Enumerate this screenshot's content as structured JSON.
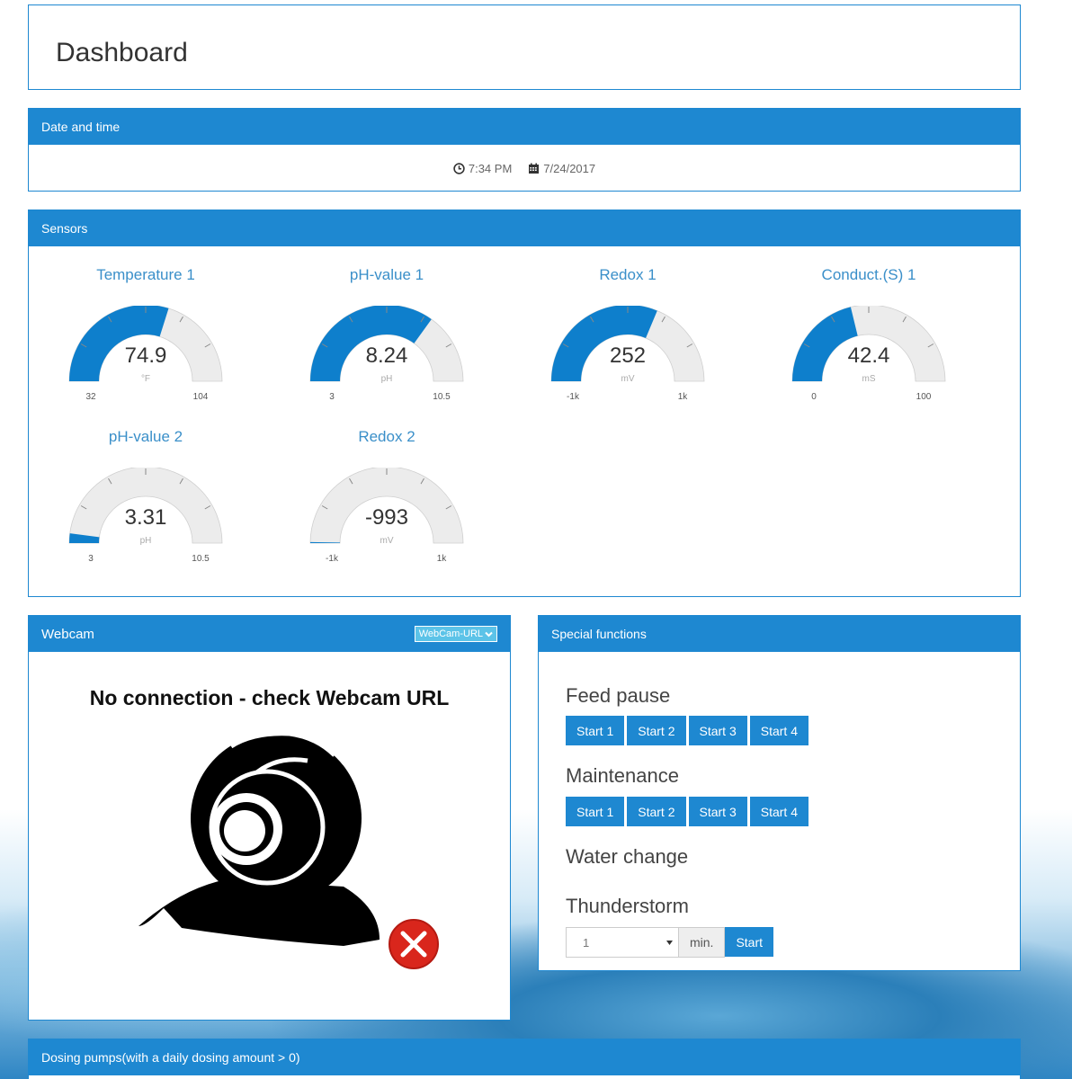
{
  "header": {
    "title": "Dashboard"
  },
  "datetime": {
    "heading": "Date and time",
    "time": "7:34 PM",
    "date": "7/24/2017",
    "time_icon": "clock-icon",
    "date_icon": "calendar-icon"
  },
  "sensors": {
    "heading": "Sensors",
    "gauges": [
      {
        "title": "Temperature 1",
        "value": "74.9",
        "unit": "°F",
        "min": "32",
        "max": "104",
        "fraction": 0.597
      },
      {
        "title": "pH-value 1",
        "value": "8.24",
        "unit": "pH",
        "min": "3",
        "max": "10.5",
        "fraction": 0.699
      },
      {
        "title": "Redox 1",
        "value": "252",
        "unit": "mV",
        "min": "-1k",
        "max": "1k",
        "fraction": 0.626
      },
      {
        "title": "Conduct.(S) 1",
        "value": "42.4",
        "unit": "mS",
        "min": "0",
        "max": "100",
        "fraction": 0.424
      },
      {
        "title": "pH-value 2",
        "value": "3.31",
        "unit": "pH",
        "min": "3",
        "max": "10.5",
        "fraction": 0.041
      },
      {
        "title": "Redox 2",
        "value": "-993",
        "unit": "mV",
        "min": "-1k",
        "max": "1k",
        "fraction": 0.004
      }
    ],
    "colors": {
      "fill": "#0e7fcc",
      "track": "#ececec"
    }
  },
  "webcam": {
    "heading": "Webcam",
    "url_button": "WebCam-URL",
    "message": "No connection - check Webcam URL"
  },
  "special": {
    "heading": "Special functions",
    "feed_pause": {
      "label": "Feed pause",
      "buttons": [
        "Start 1",
        "Start 2",
        "Start 3",
        "Start 4"
      ]
    },
    "maintenance": {
      "label": "Maintenance",
      "buttons": [
        "Start 1",
        "Start 2",
        "Start 3",
        "Start 4"
      ]
    },
    "water_change": {
      "label": "Water change"
    },
    "thunderstorm": {
      "label": "Thunderstorm",
      "duration": "1",
      "unit": "min.",
      "start": "Start"
    }
  },
  "dosing": {
    "heading": "Dosing pumps(with a daily dosing amount > 0)"
  }
}
